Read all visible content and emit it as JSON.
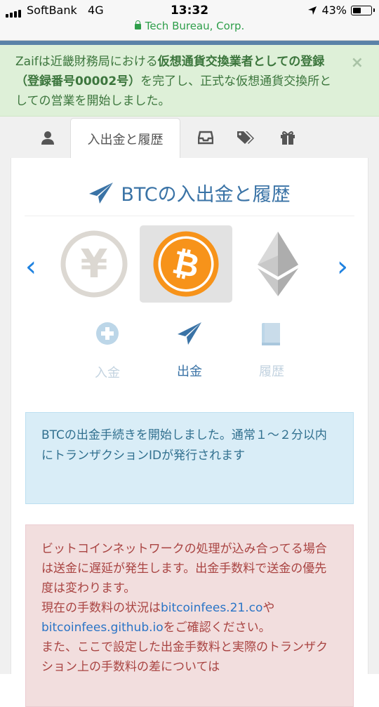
{
  "status": {
    "carrier": "SoftBank",
    "network": "4G",
    "time": "13:32",
    "battery": "43%"
  },
  "browser": {
    "site_label": "Tech Bureau, Corp."
  },
  "notice": {
    "part1": "Zaifは近畿財務局における",
    "part2_bold": "仮想通貨交換業者としての登録（登録番号00002号）",
    "part3": "を完了し、正式な仮想通貨交換所としての営業を開始しました。",
    "close": "×"
  },
  "tabs": {
    "active_label": "入出金と履歴",
    "icons": [
      "user-icon",
      "inbox-icon",
      "tags-icon",
      "gift-icon"
    ]
  },
  "page": {
    "title": "BTCの入出金と履歴"
  },
  "coins": {
    "prev": "‹",
    "next": "›",
    "yen_symbol": "¥",
    "btc_symbol": "₿"
  },
  "actions": {
    "deposit": "入金",
    "withdraw": "出金",
    "history": "履歴"
  },
  "info_message": "BTCの出金手続きを開始しました。通常１〜２分以内にトランザクションIDが発行されます",
  "warning": {
    "line1": "ビットコインネットワークの処理が込み合ってる場合は送金に遅延が発生します。出金手数料で送金の優先度は変わります。",
    "line2_prefix": "現在の手数料の状況は",
    "link1": "bitcoinfees.21.co",
    "joiner": "や",
    "link2": "bitcoinfees.github.io",
    "line2_suffix": "をご確認ください。",
    "line3": "また、ここで設定した出金手数料と実際のトランザクション上の手数料の差については"
  },
  "colors": {
    "accent": "#3a73a6",
    "link": "#1f82e0",
    "bitcoin": "#f7931a",
    "success_bg": "#def0d8",
    "info_bg": "#d9edf7",
    "danger_bg": "#f2dede"
  }
}
